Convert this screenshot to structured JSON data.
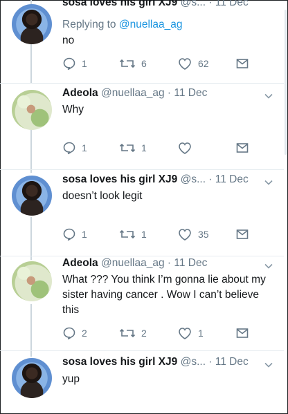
{
  "tweets": [
    {
      "name": "sosa loves his girl XJ9",
      "handle": "@s...",
      "date": "11 Dec",
      "reply_prefix": "Replying to ",
      "reply_handle": "@nuellaa_ag",
      "text": "no",
      "replies": "1",
      "retweets": "6",
      "likes": "62"
    },
    {
      "name": "Adeola",
      "handle": "@nuellaa_ag",
      "date": "11 Dec",
      "text": "Why",
      "replies": "1",
      "retweets": "1",
      "likes": ""
    },
    {
      "name": "sosa loves his girl XJ9",
      "handle": "@s...",
      "date": "11 Dec",
      "text": "doesn’t look legit",
      "replies": "1",
      "retweets": "1",
      "likes": "35"
    },
    {
      "name": "Adeola",
      "handle": "@nuellaa_ag",
      "date": "11 Dec",
      "text": "What ??? You think I’m gonna lie about my sister having cancer . Wow I can’t believe this",
      "replies": "2",
      "retweets": "2",
      "likes": "1"
    },
    {
      "name": "sosa loves his girl XJ9",
      "handle": "@s...",
      "date": "11 Dec",
      "text": "yup"
    }
  ],
  "separator": " · ",
  "icons": {
    "reply": "reply-icon",
    "retweet": "retweet-icon",
    "like": "heart-icon",
    "dm": "envelope-icon",
    "more": "chevron-down-icon"
  },
  "colors": {
    "text": "#14171a",
    "secondary": "#657786",
    "link": "#1b95e0",
    "thread_line": "#ccd6dd",
    "divider": "#e6ecf0"
  }
}
